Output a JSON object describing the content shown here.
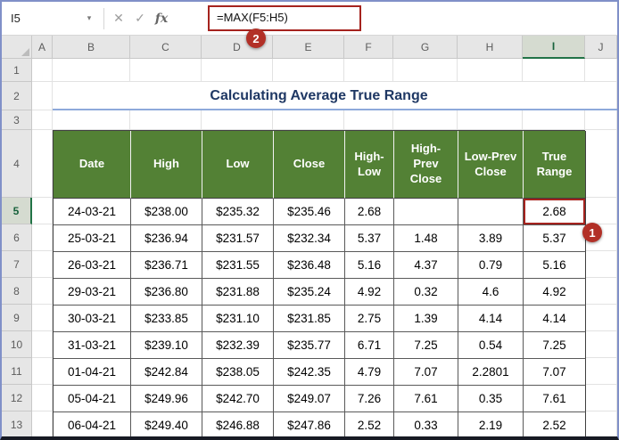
{
  "colors": {
    "header_green": "#538135",
    "selected_header_green": "#217346",
    "title_blue": "#1F3864",
    "annotation_red": "#B23027",
    "formula_highlight_red": "#A5231E",
    "title_underline_blue": "#8EA9DB"
  },
  "formula_bar": {
    "name_box_value": "I5",
    "name_box_caret": "▾",
    "cancel_icon": "✕",
    "enter_icon": "✓",
    "fx_label": "fx",
    "formula": "=MAX(F5:H5)"
  },
  "annotations": {
    "badge_1": "1",
    "badge_2": "2"
  },
  "sheet": {
    "columns": [
      "A",
      "B",
      "C",
      "D",
      "E",
      "F",
      "G",
      "H",
      "I",
      "J"
    ],
    "rows": [
      "1",
      "2",
      "3",
      "4",
      "5",
      "6",
      "7",
      "8",
      "9",
      "10",
      "11",
      "12",
      "13"
    ],
    "selected_column": "I",
    "selected_row": "5",
    "title": "Calculating Average True Range"
  },
  "table": {
    "headers": [
      "Date",
      "High",
      "Low",
      "Close",
      "High-Low",
      "High-Prev Close",
      "Low-Prev Close",
      "True Range"
    ],
    "rows": [
      [
        "24-03-21",
        "$238.00",
        "$235.32",
        "$235.46",
        "2.68",
        "",
        "",
        "2.68"
      ],
      [
        "25-03-21",
        "$236.94",
        "$231.57",
        "$232.34",
        "5.37",
        "1.48",
        "3.89",
        "5.37"
      ],
      [
        "26-03-21",
        "$236.71",
        "$231.55",
        "$236.48",
        "5.16",
        "4.37",
        "0.79",
        "5.16"
      ],
      [
        "29-03-21",
        "$236.80",
        "$231.88",
        "$235.24",
        "4.92",
        "0.32",
        "4.6",
        "4.92"
      ],
      [
        "30-03-21",
        "$233.85",
        "$231.10",
        "$231.85",
        "2.75",
        "1.39",
        "4.14",
        "4.14"
      ],
      [
        "31-03-21",
        "$239.10",
        "$232.39",
        "$235.77",
        "6.71",
        "7.25",
        "0.54",
        "7.25"
      ],
      [
        "01-04-21",
        "$242.84",
        "$238.05",
        "$242.35",
        "4.79",
        "7.07",
        "2.2801",
        "7.07"
      ],
      [
        "05-04-21",
        "$249.96",
        "$242.70",
        "$249.07",
        "7.26",
        "7.61",
        "0.35",
        "7.61"
      ],
      [
        "06-04-21",
        "$249.40",
        "$246.88",
        "$247.86",
        "2.52",
        "0.33",
        "2.19",
        "2.52"
      ]
    ],
    "selected_cell": {
      "row": 0,
      "col": 7,
      "value": "2.68"
    }
  }
}
